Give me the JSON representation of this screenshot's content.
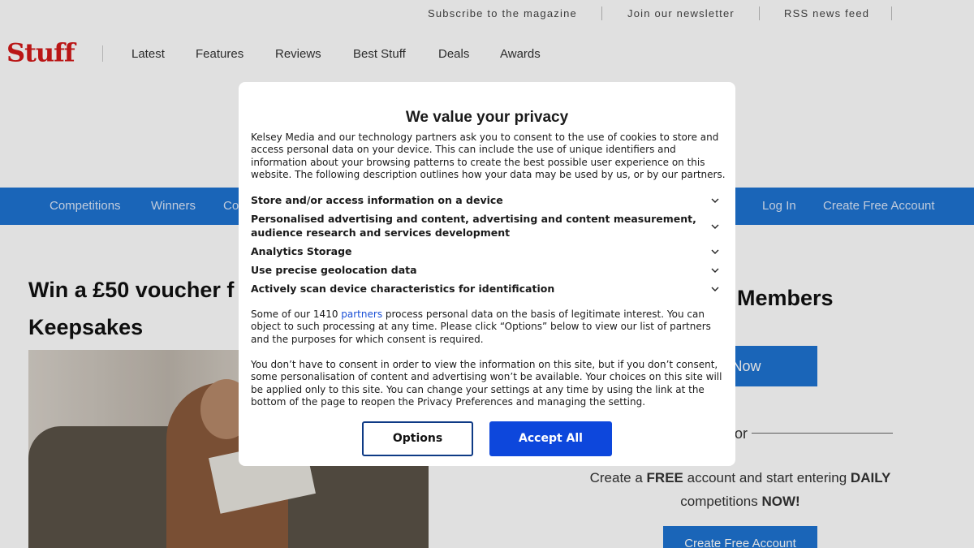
{
  "topbar": {
    "links": [
      "Subscribe to the magazine",
      "Join our newsletter",
      "RSS news feed"
    ]
  },
  "header": {
    "logo_text": "Stuff",
    "nav": [
      "Latest",
      "Features",
      "Reviews",
      "Best Stuff",
      "Deals",
      "Awards"
    ]
  },
  "subnav": {
    "left": [
      "Competitions",
      "Winners",
      "Co"
    ],
    "right": [
      "Log In",
      "Create Free Account"
    ]
  },
  "main": {
    "headline_line1": "Win a £50 voucher f",
    "headline_line2": "Keepsakes"
  },
  "sidebar": {
    "heading": "Members",
    "join_button": "n Now",
    "or_text": "or",
    "create_text_parts": [
      "Create a ",
      "FREE",
      " account and start entering ",
      "DAILY",
      " competitions ",
      "NOW!"
    ],
    "create_button": "Create Free Account"
  },
  "consent": {
    "title": "We value your privacy",
    "intro": "Kelsey Media and our technology partners ask you to consent to the use of cookies to store and access personal data on your device. This can include the use of unique identifiers and information about your browsing patterns to create the best possible user experience on this website. The following description outlines how your data may be used by us, or by our partners.",
    "purposes": [
      "Store and/or access information on a device",
      "Personalised advertising and content, advertising and content measurement, audience research and services development",
      "Analytics Storage",
      "Use precise geolocation data",
      "Actively scan device characteristics for identification"
    ],
    "legit_before": "Some of our 1410 ",
    "legit_link": "partners",
    "legit_after": " process personal data on the basis of legitimate interest. You can object to such processing at any time. Please click “Options” below to view our list of partners and the purposes for which consent is required.",
    "no_consent": "You don’t have to consent in order to view the information on this site, but if you don’t consent, some personalisation of content and advertising won’t be available. Your choices on this site will be applied only to this site. You can change your settings at any time by using the link at the bottom of the page to reopen the Privacy Preferences and managing the setting.",
    "options_label": "Options",
    "accept_label": "Accept All"
  },
  "icons": {
    "purpose_toggle": "chevron-down-icon"
  },
  "colors": {
    "brand_red": "#d41a1a",
    "subnav_blue": "#1e73d2",
    "accept_blue": "#0d47dc",
    "options_border": "#0e3a85"
  }
}
